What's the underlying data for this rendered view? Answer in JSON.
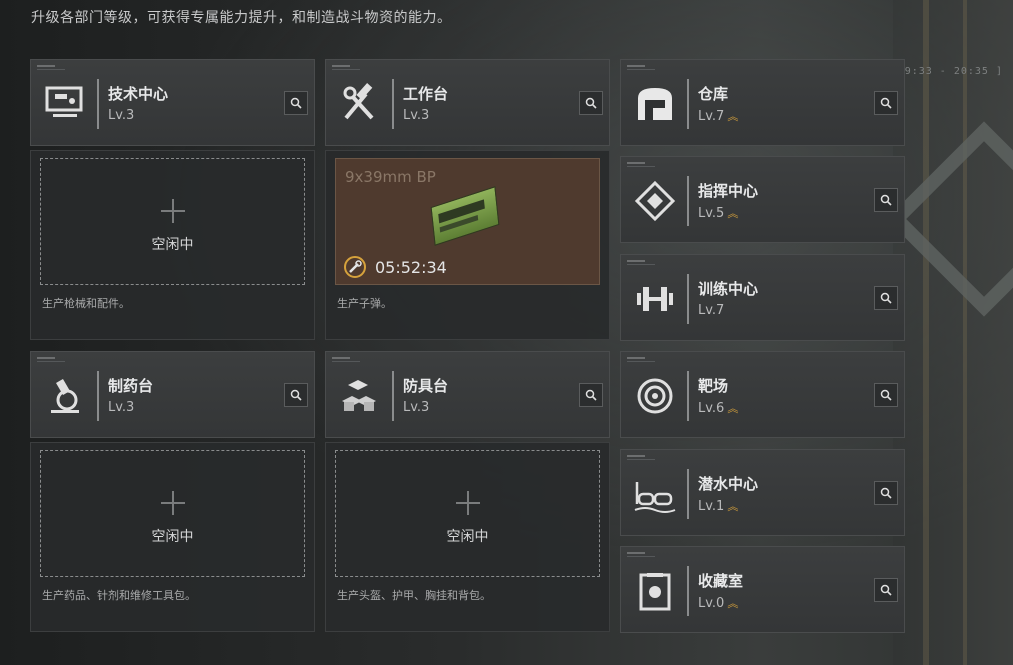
{
  "intro": "升级各部门等级，可获得专属能力提升，和制造战斗物资的能力。",
  "coord_readout": "[ 19:33 - 20:35 ]",
  "colors": {
    "accent_upgrade": "#d6a23c",
    "card_bg": "#3a3c3d",
    "production_bg": "#4f3a2e"
  },
  "departments_main": [
    {
      "name": "技术中心",
      "level": "Lv.3",
      "icon": "tech-center-icon",
      "upgradable": false
    },
    {
      "name": "工作台",
      "level": "Lv.3",
      "icon": "workbench-icon",
      "upgradable": false
    },
    {
      "name": "制药台",
      "level": "Lv.3",
      "icon": "pharmacy-icon",
      "upgradable": false
    },
    {
      "name": "防具台",
      "level": "Lv.3",
      "icon": "armor-bench-icon",
      "upgradable": false
    }
  ],
  "slots": [
    {
      "state": "idle",
      "idle_label": "空闲中",
      "desc": "生产枪械和配件。"
    },
    {
      "state": "producing",
      "item": "9x39mm BP",
      "time": "05:52:34",
      "desc": "生产子弹。"
    },
    {
      "state": "idle",
      "idle_label": "空闲中",
      "desc": "生产药品、针剂和维修工具包。"
    },
    {
      "state": "idle",
      "idle_label": "空闲中",
      "desc": "生产头盔、护甲、胸挂和背包。"
    }
  ],
  "departments_side": [
    {
      "name": "仓库",
      "level": "Lv.7",
      "icon": "warehouse-icon",
      "upgradable": true,
      "upgrade_mark": "︽"
    },
    {
      "name": "指挥中心",
      "level": "Lv.5",
      "icon": "command-center-icon",
      "upgradable": true,
      "upgrade_mark": "︽"
    },
    {
      "name": "训练中心",
      "level": "Lv.7",
      "icon": "training-center-icon",
      "upgradable": false,
      "upgrade_mark": ""
    },
    {
      "name": "靶场",
      "level": "Lv.6",
      "icon": "shooting-range-icon",
      "upgradable": true,
      "upgrade_mark": "︽"
    },
    {
      "name": "潜水中心",
      "level": "Lv.1",
      "icon": "diving-center-icon",
      "upgradable": true,
      "upgrade_mark": "︽"
    },
    {
      "name": "收藏室",
      "level": "Lv.0",
      "icon": "collection-room-icon",
      "upgradable": true,
      "upgrade_mark": "︽"
    }
  ]
}
